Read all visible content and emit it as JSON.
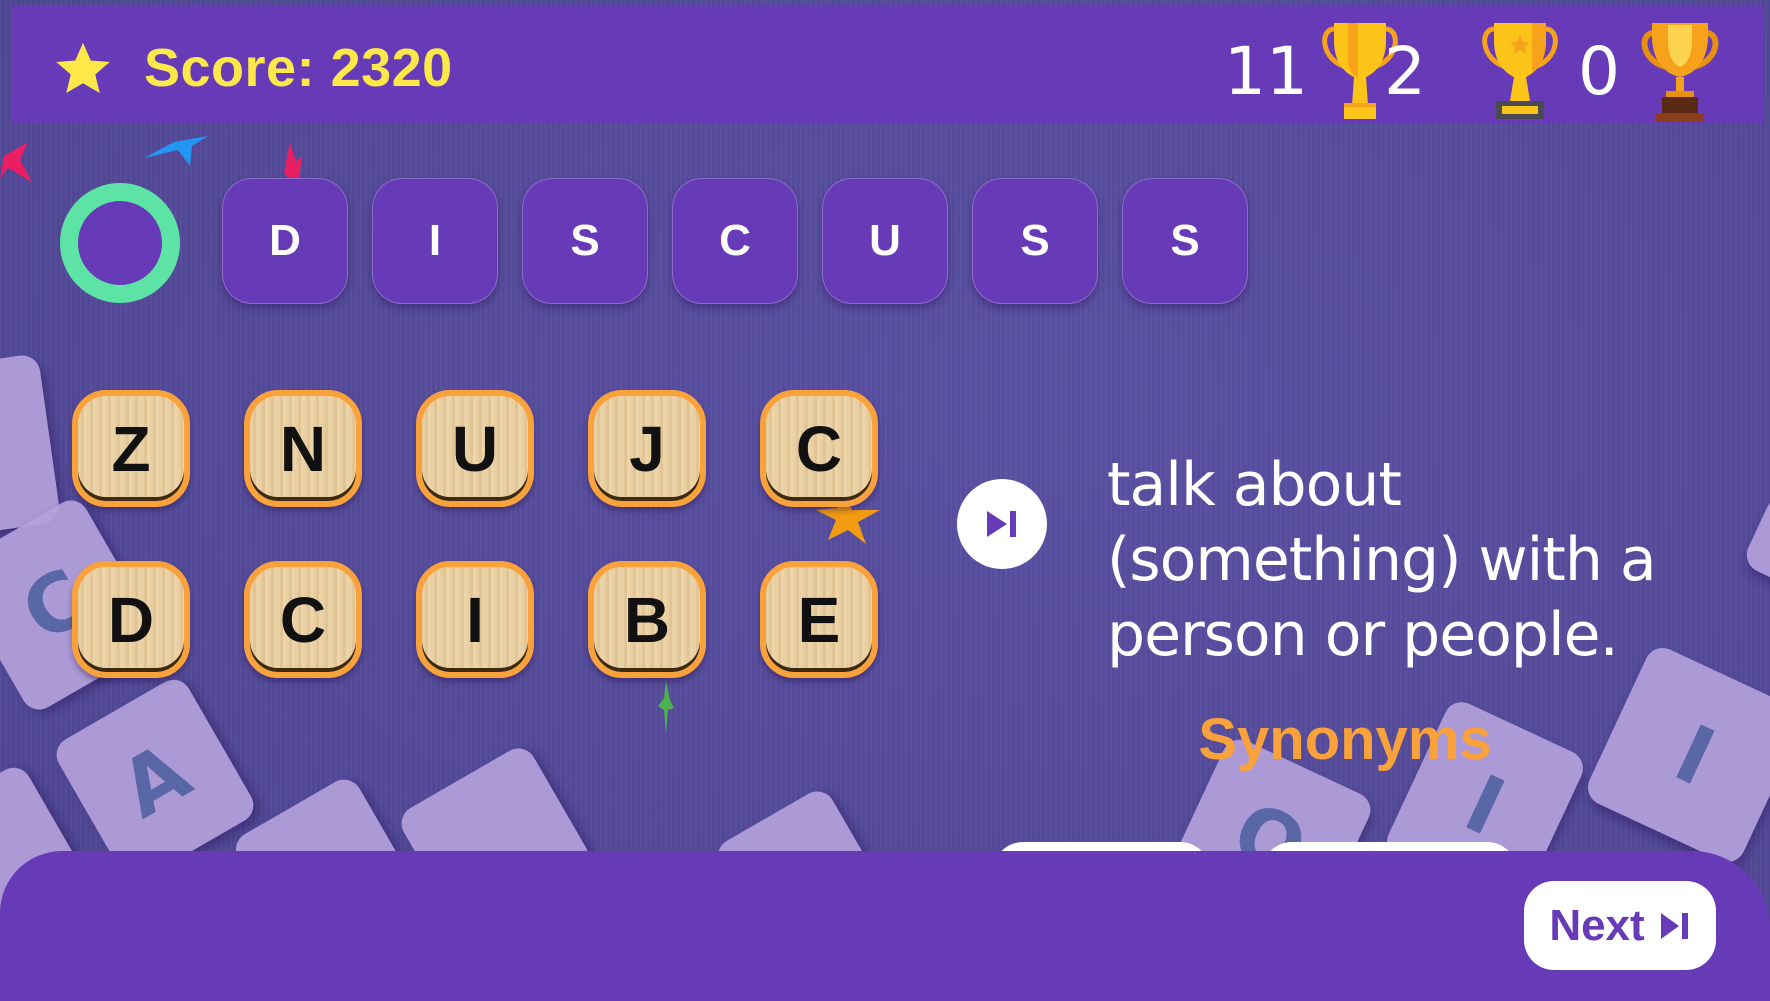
{
  "header": {
    "score_label": "Score: 2320",
    "trophies": [
      {
        "count": "11",
        "icon": "trophy-gold-icon"
      },
      {
        "count": "2",
        "icon": "trophy-star-icon"
      },
      {
        "count": "0",
        "icon": "trophy-bronze-base-icon"
      }
    ]
  },
  "answer": {
    "status_icon": "ring-icon",
    "letters": [
      "D",
      "I",
      "S",
      "C",
      "U",
      "S",
      "S"
    ]
  },
  "letter_pool": {
    "row1": [
      "Z",
      "N",
      "U",
      "J",
      "C"
    ],
    "row2": [
      "D",
      "C",
      "I",
      "B",
      "E"
    ]
  },
  "clue": {
    "skip_icon": "skip-next-icon",
    "definition": "talk about (something) with a person or people.",
    "synonyms_title": "Synonyms"
  },
  "footer": {
    "next_label": "Next"
  },
  "colors": {
    "primary": "#673ab7",
    "score": "#fde84a",
    "accent": "#f9a23c",
    "ring": "#5de3a6",
    "background": "#574c9c"
  }
}
